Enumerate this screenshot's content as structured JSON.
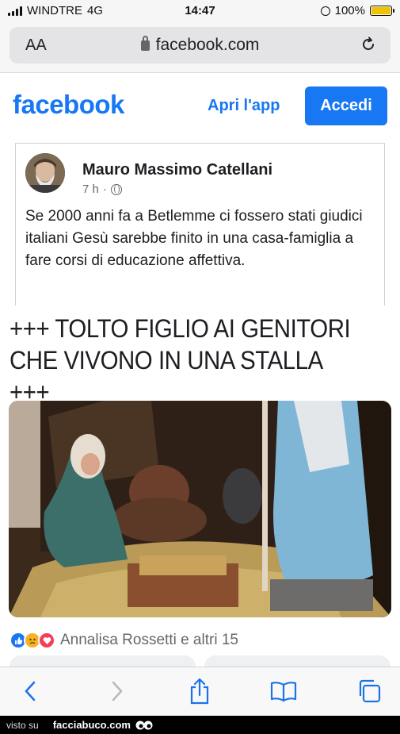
{
  "status_bar": {
    "carrier": "WINDTRE",
    "network": "4G",
    "time": "14:47",
    "battery": "100%",
    "battery_level": 1.0
  },
  "browser": {
    "text_size_label": "AA",
    "url": "facebook.com",
    "reload_icon": "reload-icon"
  },
  "fb_header": {
    "logo": "facebook",
    "open_app_label": "Apri l'app",
    "login_label": "Accedi"
  },
  "post": {
    "author": "Mauro Massimo Catellani",
    "time": "7 h",
    "separator": "·",
    "text": "Se 2000 anni fa a Betlemme ci fossero stati giudici italiani Gesù sarebbe finito in una casa-famiglia a fare corsi di educazione affettiva."
  },
  "headline": {
    "line1": "+++ TOLTO FIGLIO AI GENITORI",
    "line2": "CHE VIVONO IN UNA STALLA +++"
  },
  "reactions": {
    "icons": [
      "like-icon",
      "sad-icon",
      "love-icon"
    ],
    "summary": "Annalisa Rossetti e altri 15"
  },
  "toolbar": {
    "icons": [
      "back-icon",
      "forward-icon",
      "share-icon",
      "bookmarks-icon",
      "tabs-icon"
    ]
  },
  "watermark": {
    "prefix": "visto su",
    "site": "facciabuco.com"
  },
  "colors": {
    "brand_blue": "#1877f2",
    "text_dark": "#1c1e21",
    "text_muted": "#65676b",
    "safari_blue": "#1a73e8"
  }
}
